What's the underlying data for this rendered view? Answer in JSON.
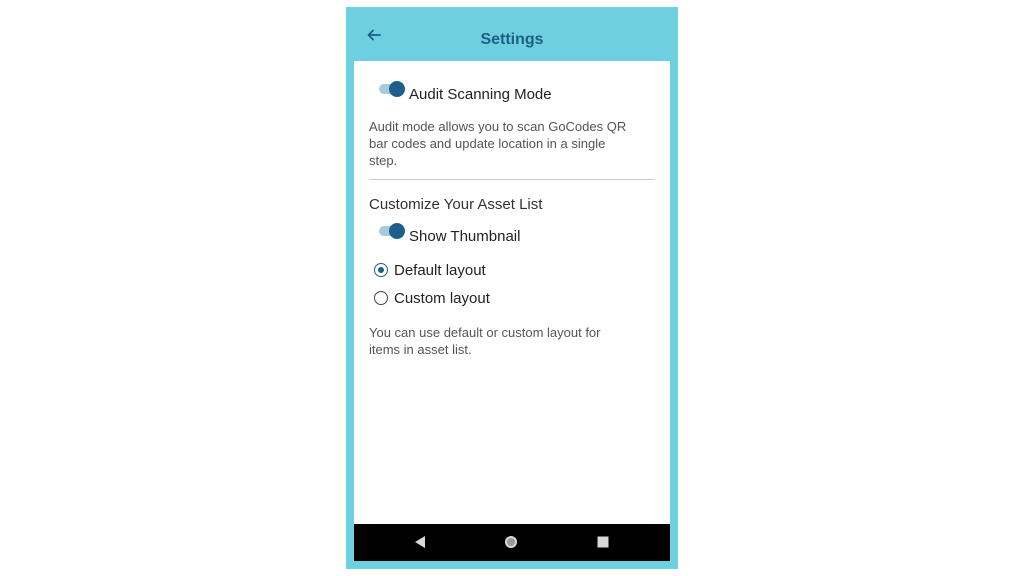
{
  "header": {
    "title": "Settings",
    "back_icon": "arrow-left-icon"
  },
  "audit": {
    "toggle_label": "Audit Scanning Mode",
    "toggle_on": true,
    "description_lines": [
      "Audit mode allows you to scan GoCodes QR",
      "bar codes and update location in a single",
      "step."
    ]
  },
  "asset_list": {
    "section_title": "Customize Your Asset List",
    "thumbnail_label": "Show Thumbnail",
    "thumbnail_on": true,
    "layouts": [
      {
        "label": "Default layout",
        "selected": true
      },
      {
        "label": "Custom layout",
        "selected": false
      }
    ],
    "description_lines": [
      "You can use default or custom layout for",
      "items in asset list."
    ]
  },
  "nav": {
    "buttons": [
      "back-triangle-icon",
      "home-circle-icon",
      "recents-square-icon"
    ]
  },
  "colors": {
    "frame": "#6dcfe0",
    "accent": "#1d5f8a",
    "title": "#1f5f86"
  }
}
